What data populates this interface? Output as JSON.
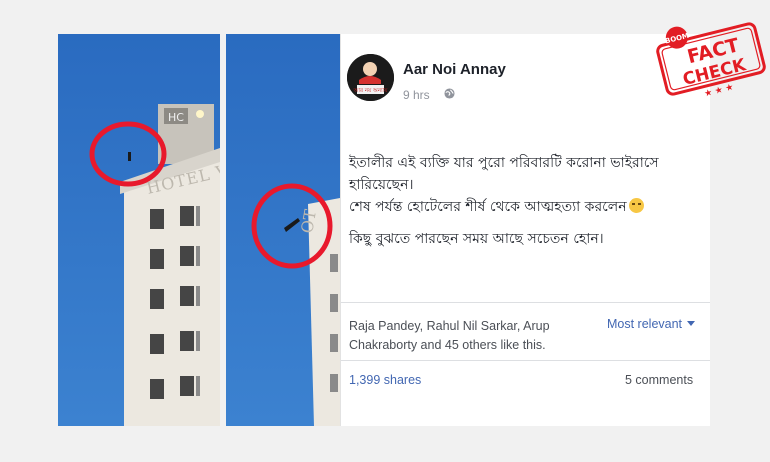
{
  "post": {
    "page_name": "Aar Noi Annay",
    "avatar_text": "আর নয় অন্যায়",
    "time": "9 hrs",
    "privacy_icon": "globe-icon",
    "text_lines": [
      "ইতালীর এই ব্যক্তি যার পুরো পরিবারটি করোনা ভাইরাসে হারিয়েছেন।",
      "শেষ পর্যন্ত হোটেলের শীর্ষ থেকে আত্মহত্যা করলেন",
      "কিছু বুঝতে পারছেন সময় আছে সচেতন হোন।"
    ],
    "emoji": "sad-face-emoji",
    "likes_summary": "Raja Pandey, Rahul Nil Sarkar, Arup Chakraborty and 45 others like this.",
    "sort_label": "Most relevant",
    "shares": "1,399 shares",
    "comments": "5 comments"
  },
  "photo": {
    "building_sign": "HOTEL VALEN",
    "building_sign_right": "ОТ",
    "rooftop_sign": "НС"
  },
  "stamp": {
    "brand": "BOOM",
    "line1": "FACT",
    "line2": "CHECK",
    "color": "#e21d24"
  },
  "colors": {
    "sky": "#2f74c6",
    "link": "#4267b2",
    "circle": "#e8192c"
  }
}
